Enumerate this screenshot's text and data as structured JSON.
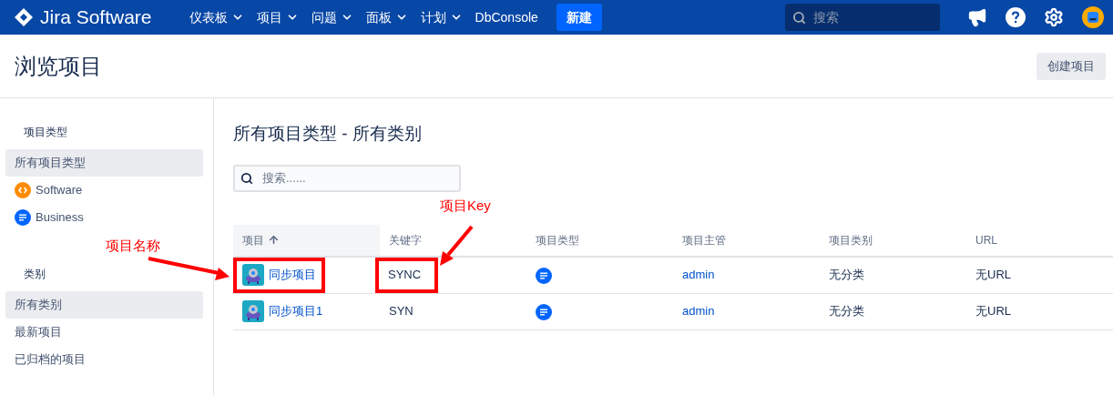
{
  "header": {
    "logo": "Jira Software",
    "nav": [
      {
        "label": "仪表板",
        "dropdown": true
      },
      {
        "label": "项目",
        "dropdown": true
      },
      {
        "label": "问题",
        "dropdown": true
      },
      {
        "label": "面板",
        "dropdown": true
      },
      {
        "label": "计划",
        "dropdown": true
      },
      {
        "label": "DbConsole",
        "dropdown": false
      }
    ],
    "create_button": "新建",
    "search": {
      "placeholder": "搜索"
    }
  },
  "page": {
    "title": "浏览项目",
    "create_project_button": "创建项目"
  },
  "sidebar": [
    {
      "heading": "项目类型",
      "items": [
        {
          "label": "所有项目类型",
          "selected": true,
          "kind": "plain"
        },
        {
          "label": "Software",
          "selected": false,
          "kind": "software"
        },
        {
          "label": "Business",
          "selected": false,
          "kind": "business"
        }
      ]
    },
    {
      "heading": "类别",
      "items": [
        {
          "label": "所有类别",
          "selected": true,
          "kind": "plain"
        },
        {
          "label": "最新项目",
          "selected": false,
          "kind": "plain"
        },
        {
          "label": "已归档的项目",
          "selected": false,
          "kind": "plain"
        }
      ]
    }
  ],
  "main": {
    "heading": "所有项目类型 - 所有类别",
    "search": {
      "placeholder": "搜索......"
    },
    "table": {
      "columns": [
        {
          "label": "项目",
          "sorted": true
        },
        {
          "label": "关键字",
          "sorted": false
        },
        {
          "label": "项目类型",
          "sorted": false
        },
        {
          "label": "项目主管",
          "sorted": false
        },
        {
          "label": "项目类别",
          "sorted": false
        },
        {
          "label": "URL",
          "sorted": false
        }
      ],
      "rows": [
        {
          "name": "同步项目",
          "name_highlighted": true,
          "key": "SYNC",
          "key_highlighted": true,
          "kind": "business",
          "lead": "admin",
          "category": "无分类",
          "url": "无URL"
        },
        {
          "name": "同步项目1",
          "name_highlighted": false,
          "key": "SYN",
          "key_highlighted": false,
          "kind": "business",
          "lead": "admin",
          "category": "无分类",
          "url": "无URL"
        }
      ]
    }
  },
  "annotations": {
    "name_label": "项目名称",
    "key_label": "项目Key"
  }
}
